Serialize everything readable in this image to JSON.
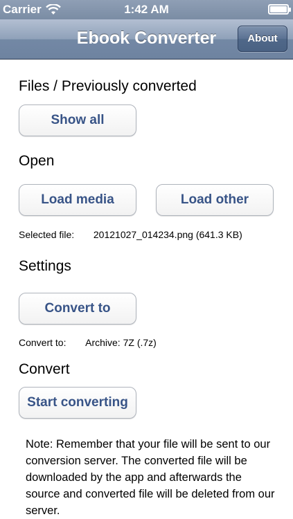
{
  "status_bar": {
    "carrier": "Carrier",
    "time": "1:42 AM"
  },
  "nav_bar": {
    "title": "Ebook Converter",
    "about_label": "About"
  },
  "files_section": {
    "heading": "Files / Previously converted",
    "show_all_label": "Show all"
  },
  "open_section": {
    "heading": "Open",
    "load_media_label": "Load media",
    "load_other_label": "Load other",
    "selected_file_label": "Selected file:",
    "selected_file_value": "20121027_014234.png (641.3 KB)"
  },
  "settings_section": {
    "heading": "Settings",
    "convert_to_button_label": "Convert to",
    "convert_to_label": "Convert to:",
    "convert_to_value": "Archive: 7Z (.7z)"
  },
  "convert_section": {
    "heading": "Convert",
    "start_label": "Start converting"
  },
  "note": "Note: Remember that your file will be sent to our conversion server. The converted file will be downloaded by the app and afterwards the source and converted file will be deleted from our server.",
  "colors": {
    "nav_bar": "#8fa1b9",
    "button_text": "#385487",
    "button_border": "#aeb3bb"
  }
}
